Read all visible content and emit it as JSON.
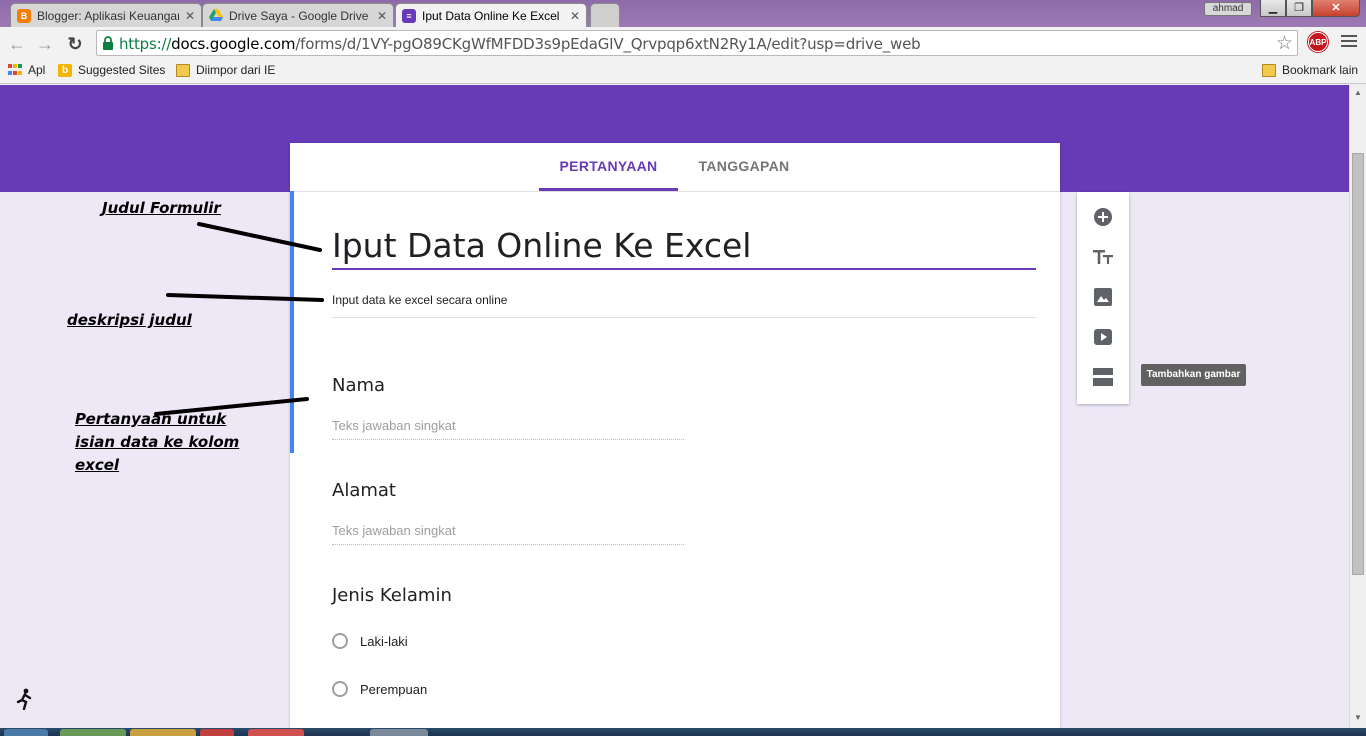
{
  "browser": {
    "tabs": [
      {
        "title": "Blogger: Aplikasi Keuangan",
        "favicon": "blogger-icon",
        "color": "#f57d00"
      },
      {
        "title": "Drive Saya - Google Drive",
        "favicon": "drive-icon",
        "color": "#1fa463"
      },
      {
        "title": "Iput Data Online Ke Excel",
        "favicon": "forms-icon",
        "color": "#673ab7"
      }
    ],
    "profile": "ahmad",
    "url_scheme": "https://",
    "url_host": "docs.google.com",
    "url_path": "/forms/d/1VY-pgO89CKgWfMFDD3s9pEdaGIV_Qrvpqp6xtN2Ry1A/edit?usp=drive_web",
    "abp_label": "ABP"
  },
  "bookmarks": {
    "apps": "Apl",
    "suggested": "Suggested Sites",
    "imported": "Diimpor dari IE",
    "other": "Bookmark lain"
  },
  "form": {
    "tabs": {
      "questions": "PERTANYAAN",
      "responses": "TANGGAPAN"
    },
    "title": "Iput Data Online Ke Excel",
    "description": "Input data ke excel secara online",
    "questions": [
      {
        "title": "Nama",
        "placeholder": "Teks jawaban singkat"
      },
      {
        "title": "Alamat",
        "placeholder": "Teks jawaban singkat"
      },
      {
        "title": "Jenis Kelamin",
        "options": [
          "Laki-laki",
          "Perempuan"
        ]
      }
    ],
    "accent": "#673ab7"
  },
  "sidebar": {
    "buttons": [
      "add-question-icon",
      "title-text-icon",
      "image-icon",
      "video-icon",
      "section-icon"
    ],
    "tooltip": "Tambahkan gambar"
  },
  "annotations": {
    "title": "Judul Formulir",
    "description": "deskripsi judul",
    "questions_line1": "Pertanyaan untuk",
    "questions_line2": "isian data ke kolom",
    "questions_line3": "excel"
  }
}
